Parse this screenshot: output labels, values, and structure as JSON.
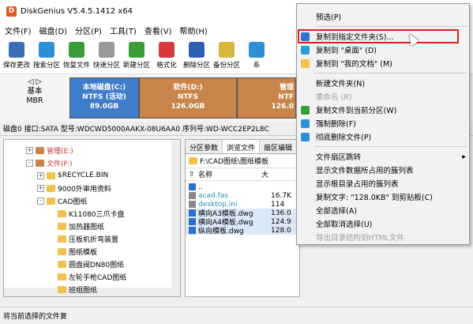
{
  "app": {
    "title": "DiskGenius V5.4.5.1412 x64"
  },
  "menu": [
    "文件(F)",
    "磁盘(D)",
    "分区(P)",
    "工具(T)",
    "查看(V)",
    "帮助(H)"
  ],
  "toolbar": [
    {
      "label": "保存更改",
      "color": "#3a6fb5"
    },
    {
      "label": "搜索分区",
      "color": "#2d8fd6"
    },
    {
      "label": "恢复文件",
      "color": "#3a9d3a"
    },
    {
      "label": "快速分区",
      "color": "#999999"
    },
    {
      "label": "新建分区",
      "color": "#3a9d3a"
    },
    {
      "label": "格式化",
      "color": "#d63a3a"
    },
    {
      "label": "删除分区",
      "color": "#2d5fb5"
    },
    {
      "label": "备份分区",
      "color": "#d6b83a"
    },
    {
      "label": "系",
      "color": "#2d8fd6"
    }
  ],
  "disk": {
    "nav": [
      "基本",
      "MBR"
    ],
    "partitions": [
      {
        "name": "本地磁盘(C:)",
        "fs": "NTFS (活动)",
        "size": "89.0GB",
        "color": "#3f7cc9"
      },
      {
        "name": "软件(D:)",
        "fs": "NTFS",
        "size": "126.0GB",
        "color": "#c9844a"
      },
      {
        "name": "管理",
        "fs": "NTF",
        "size": "126.0",
        "color": "#c9844a"
      }
    ],
    "info": "磁盘0 接口:SATA  型号:WDCWD5000AAKX-08U6AA0  序列号:WD-WCC2EP2L8C"
  },
  "tree": [
    {
      "indent": 0,
      "label": "管理(E:)",
      "type": "drive",
      "exp": "+"
    },
    {
      "indent": 0,
      "label": "文件(F:)",
      "type": "drive",
      "exp": "-"
    },
    {
      "indent": 1,
      "label": "$RECYCLE.BIN",
      "type": "folder",
      "exp": "+"
    },
    {
      "indent": 1,
      "label": "9000外审用资料",
      "type": "folder",
      "exp": "+"
    },
    {
      "indent": 1,
      "label": "CAD图纸",
      "type": "folder",
      "exp": "-"
    },
    {
      "indent": 2,
      "label": "K11080三爪卡盘",
      "type": "folder",
      "exp": ""
    },
    {
      "indent": 2,
      "label": "加热器图纸",
      "type": "folder",
      "exp": ""
    },
    {
      "indent": 2,
      "label": "压板机折弯装置",
      "type": "folder",
      "exp": ""
    },
    {
      "indent": 2,
      "label": "图纸模板",
      "type": "folder",
      "exp": ""
    },
    {
      "indent": 2,
      "label": "圆盘阀DN80图纸",
      "type": "folder",
      "exp": ""
    },
    {
      "indent": 2,
      "label": "左轮手枪CAD图纸",
      "type": "folder",
      "exp": ""
    },
    {
      "indent": 2,
      "label": "班组图纸",
      "type": "folder",
      "exp": ""
    }
  ],
  "right": {
    "tabs": [
      "分区参数",
      "浏览文件",
      "扇区编辑"
    ],
    "path": "F:\\CAD图纸\\图纸模板",
    "columns": [
      "名称",
      "大"
    ],
    "files": [
      {
        "name": "..",
        "size": "",
        "color": "#2a6fc9"
      },
      {
        "name": "acad.fas",
        "size": "16.7K",
        "color": "#888888"
      },
      {
        "name": "desktop.ini",
        "size": "114",
        "color": "#888888"
      },
      {
        "name": "横向A3模板.dwg",
        "size": "136.0",
        "color": "#2a6fc9"
      },
      {
        "name": "横向A4模板.dwg",
        "size": "124.9",
        "color": "#2a6fc9"
      },
      {
        "name": "纵向模板.dwg",
        "size": "128.0",
        "color": "#2a6fc9"
      }
    ]
  },
  "context_menu": [
    {
      "label": "预选(P)",
      "disabled": false,
      "icon": ""
    },
    {
      "label": "复制到指定文件夹(S)...",
      "disabled": false,
      "icon": "#2a6fc9"
    },
    {
      "label": "复制到 \"桌面\" (D)",
      "disabled": false,
      "icon": "#2a9fd6"
    },
    {
      "label": "复制到 \"我的文档\" (M)",
      "disabled": false,
      "icon": "#f2c24e"
    },
    {
      "label": "新建文件夹(N)",
      "disabled": false,
      "icon": ""
    },
    {
      "label": "重命名 (R)",
      "disabled": true,
      "icon": ""
    },
    {
      "label": "复制文件到当前分区(W)",
      "disabled": false,
      "icon": "#3a9d3a"
    },
    {
      "label": "强制删除(F)",
      "disabled": false,
      "icon": "#2d8fd6"
    },
    {
      "label": "彻底删除文件(P)",
      "disabled": false,
      "icon": "#2d8fd6"
    },
    {
      "label": "文件扇区跳转",
      "disabled": false,
      "icon": "",
      "submenu": true
    },
    {
      "label": "显示文件数据所占用的簇列表",
      "disabled": false,
      "icon": ""
    },
    {
      "label": "显示根目录占用的簇列表",
      "disabled": false,
      "icon": ""
    },
    {
      "label": "复制文字: \"128.0KB\" 到剪贴板(C)",
      "disabled": false,
      "icon": ""
    },
    {
      "label": "全部选择(A)",
      "disabled": false,
      "icon": ""
    },
    {
      "label": "全部取消选择(U)",
      "disabled": false,
      "icon": ""
    },
    {
      "label": "导出目录结构到HTML文件",
      "disabled": true,
      "icon": ""
    }
  ],
  "status": "将当前选择的文件复"
}
